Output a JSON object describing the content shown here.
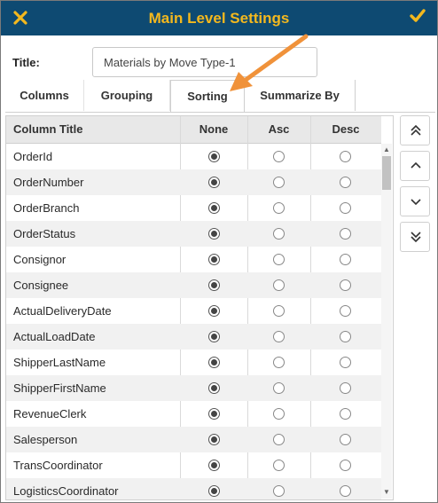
{
  "header": {
    "title": "Main Level Settings",
    "close_icon": "close-icon",
    "confirm_icon": "checkmark-icon",
    "accent_color": "#f3b81e",
    "bar_color": "#0e4a72"
  },
  "title_field": {
    "label": "Title:",
    "value": "Materials by Move Type-1"
  },
  "tabs": [
    {
      "label": "Columns"
    },
    {
      "label": "Grouping"
    },
    {
      "label": "Sorting",
      "active": true
    },
    {
      "label": "Summarize By"
    }
  ],
  "grid": {
    "headers": {
      "column_title": "Column Title",
      "none": "None",
      "asc": "Asc",
      "desc": "Desc"
    },
    "rows": [
      {
        "name": "OrderId",
        "selected": "none"
      },
      {
        "name": "OrderNumber",
        "selected": "none"
      },
      {
        "name": "OrderBranch",
        "selected": "none"
      },
      {
        "name": "OrderStatus",
        "selected": "none"
      },
      {
        "name": "Consignor",
        "selected": "none"
      },
      {
        "name": "Consignee",
        "selected": "none"
      },
      {
        "name": "ActualDeliveryDate",
        "selected": "none"
      },
      {
        "name": "ActualLoadDate",
        "selected": "none"
      },
      {
        "name": "ShipperLastName",
        "selected": "none"
      },
      {
        "name": "ShipperFirstName",
        "selected": "none"
      },
      {
        "name": "RevenueClerk",
        "selected": "none"
      },
      {
        "name": "Salesperson",
        "selected": "none"
      },
      {
        "name": "TransCoordinator",
        "selected": "none"
      },
      {
        "name": "LogisticsCoordinator",
        "selected": "none"
      }
    ]
  },
  "order_buttons": [
    {
      "name": "move-to-top-button",
      "icon": "double-chevron-up-icon"
    },
    {
      "name": "move-up-button",
      "icon": "chevron-up-icon"
    },
    {
      "name": "move-down-button",
      "icon": "chevron-down-icon"
    },
    {
      "name": "move-to-bottom-button",
      "icon": "double-chevron-down-icon"
    }
  ],
  "annotation_arrow_color": "#f0923a"
}
